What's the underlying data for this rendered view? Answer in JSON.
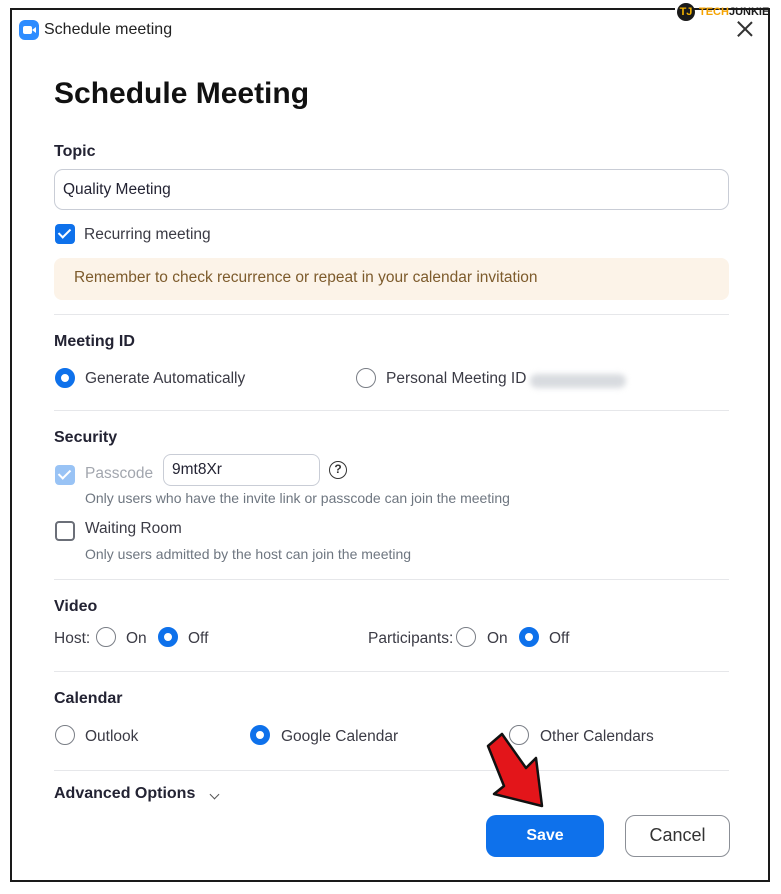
{
  "window": {
    "title": "Schedule meeting"
  },
  "watermark": {
    "tech": "TECH",
    "junkie": "JUNKIE",
    "letter": "TJ"
  },
  "heading": "Schedule Meeting",
  "topic": {
    "label": "Topic",
    "value": "Quality Meeting"
  },
  "recurring": {
    "label": "Recurring meeting",
    "checked": true
  },
  "notice": "Remember to check recurrence or repeat in your calendar invitation",
  "meeting_id": {
    "label": "Meeting ID",
    "options": [
      "Generate Automatically",
      "Personal Meeting ID"
    ],
    "selected": "Generate Automatically"
  },
  "security": {
    "label": "Security",
    "passcode_label": "Passcode",
    "passcode_value": "9mt8Xr",
    "passcode_note": "Only users who have the invite link or passcode can join the meeting",
    "waiting_room_label": "Waiting Room",
    "waiting_room_note": "Only users admitted by the host can join the meeting"
  },
  "video": {
    "label": "Video",
    "host_label": "Host:",
    "participants_label": "Participants:",
    "on_label": "On",
    "off_label": "Off",
    "host_value": "Off",
    "participants_value": "Off"
  },
  "calendar": {
    "label": "Calendar",
    "options": [
      "Outlook",
      "Google Calendar",
      "Other Calendars"
    ],
    "selected": "Google Calendar"
  },
  "advanced_options": "Advanced Options",
  "buttons": {
    "save": "Save",
    "cancel": "Cancel"
  },
  "colors": {
    "accent": "#0e71eb",
    "notice_bg": "#fcf3e8",
    "arrow": "#e3151a"
  }
}
